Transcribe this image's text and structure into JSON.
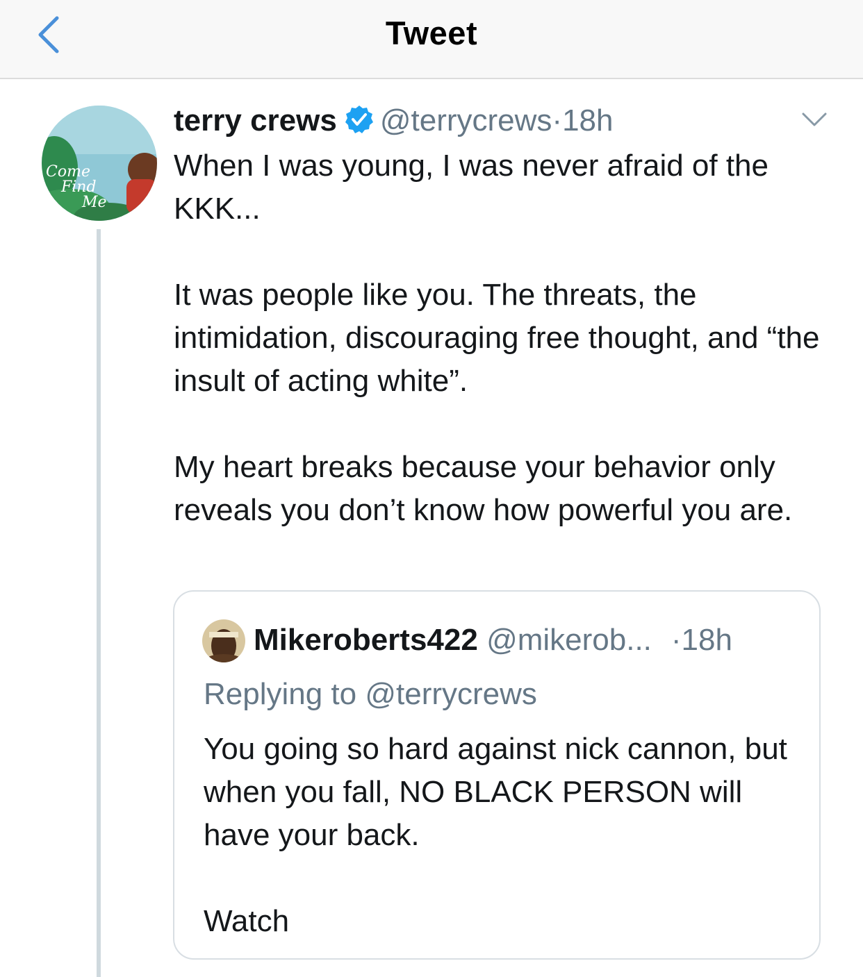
{
  "nav": {
    "title": "Tweet",
    "back_icon": "chevron-left-icon",
    "accent_color": "#4a90d9"
  },
  "tweet": {
    "display_name": "terry crews",
    "verified": true,
    "handle": "@terrycrews",
    "separator": "·",
    "time": "18h",
    "menu_icon": "chevron-down-icon",
    "text": {
      "line1": "When I was young, I was never afraid of the KKK...",
      "paragraph2": "It was people like you. The threats, the intimidation,  discouraging free thought, and “the insult of acting white”.",
      "paragraph3": "My heart breaks because your behavior only reveals you don’t know how powerful you are."
    },
    "avatar_text": [
      "Come",
      "Find",
      "Me"
    ]
  },
  "quoted_tweet": {
    "display_name": "Mikeroberts422",
    "handle": "@mikerob...",
    "time": "·18h",
    "replying_to": "Replying to @terrycrews",
    "text": {
      "paragraph1": "You going so hard against nick cannon, but when you fall, NO BLACK PERSON will have your back.",
      "paragraph2": "Watch"
    }
  },
  "colors": {
    "verified_blue": "#1da1f2",
    "secondary_text": "#657786",
    "thread_line": "#cfd9de"
  }
}
